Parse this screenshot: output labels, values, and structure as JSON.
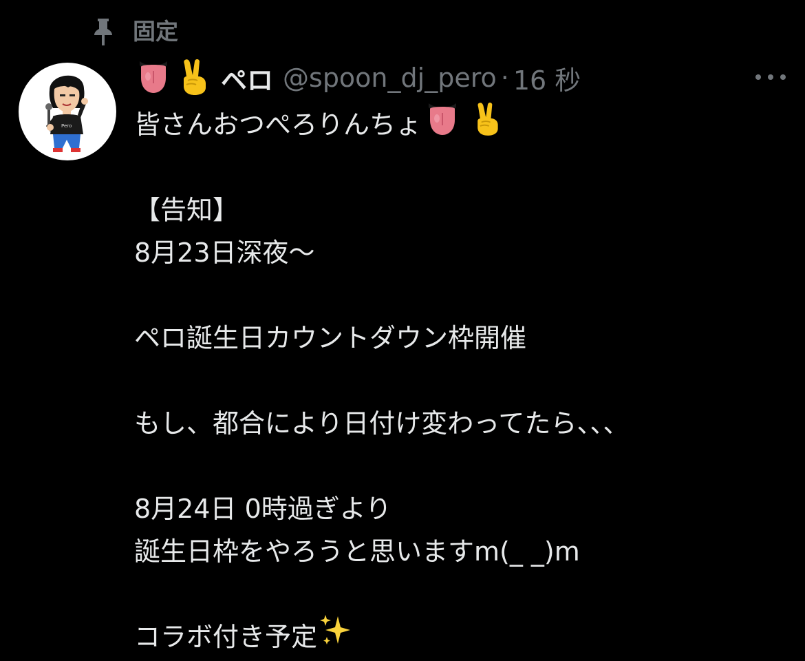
{
  "pinned": {
    "label": "固定",
    "icon": "pin-icon"
  },
  "author": {
    "avatar_icon": "avatar-image",
    "name_emojis": [
      "tongue-emoji",
      "victory-hand-emoji"
    ],
    "display_name": "ペロ",
    "handle": "@spoon_dj_pero",
    "separator": "·",
    "time": "16 秒"
  },
  "more_icon": "more-options-icon",
  "tweet": {
    "line1": "皆さんおつぺろりんちょ",
    "line1_emojis": [
      "tongue-emoji",
      "victory-hand-emoji"
    ],
    "line2": "【告知】",
    "line3": "8月23日深夜〜",
    "line4": "ペロ誕生日カウントダウン枠開催",
    "line5": "もし、都合により日付け変わってたら、、、",
    "line6": "8月24日 0時過ぎより",
    "line7": "誕生日枠をやろうと思いますm(_ _)m",
    "line8": "コラボ付き予定",
    "line8_emoji": "sparkles-emoji"
  },
  "colors": {
    "background": "#000000",
    "text": "#e7e9ea",
    "secondary": "#71767b"
  }
}
